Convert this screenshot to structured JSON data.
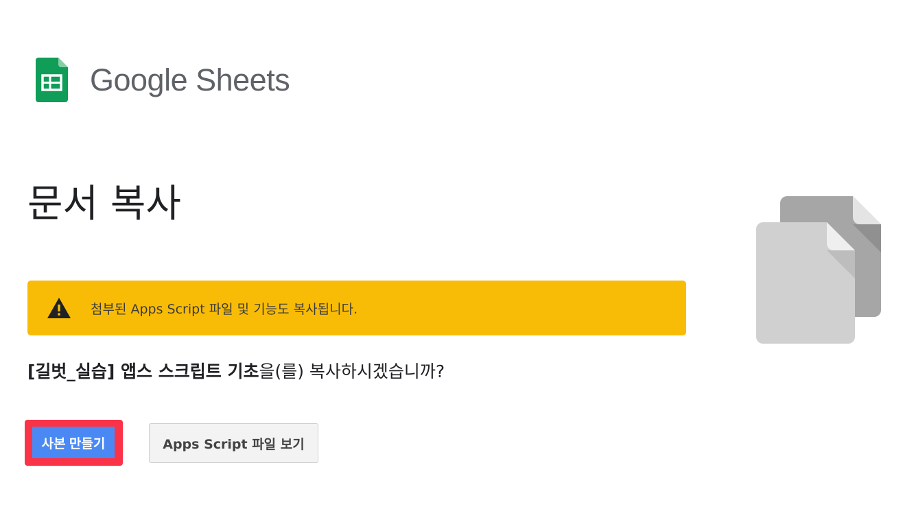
{
  "header": {
    "logo_icon": "google-sheets-icon",
    "product_name": "Google Sheets"
  },
  "main": {
    "title": "문서 복사",
    "warning": {
      "icon": "warning-triangle-icon",
      "text": "첨부된 Apps Script 파일 및 기능도 복사됩니다."
    },
    "question": {
      "doc_name": "[길벗_실습] 앱스 스크립트 기초",
      "suffix": "을(를) 복사하시겠습니까?"
    },
    "buttons": {
      "make_copy": "사본 만들기",
      "view_script": "Apps Script 파일 보기"
    },
    "illustration_icon": "copy-documents-icon"
  },
  "colors": {
    "banner": "#f9bc06",
    "primary_button": "#4a89f3",
    "highlight_border": "#fb3349",
    "sheets_green": "#0f9d58"
  }
}
